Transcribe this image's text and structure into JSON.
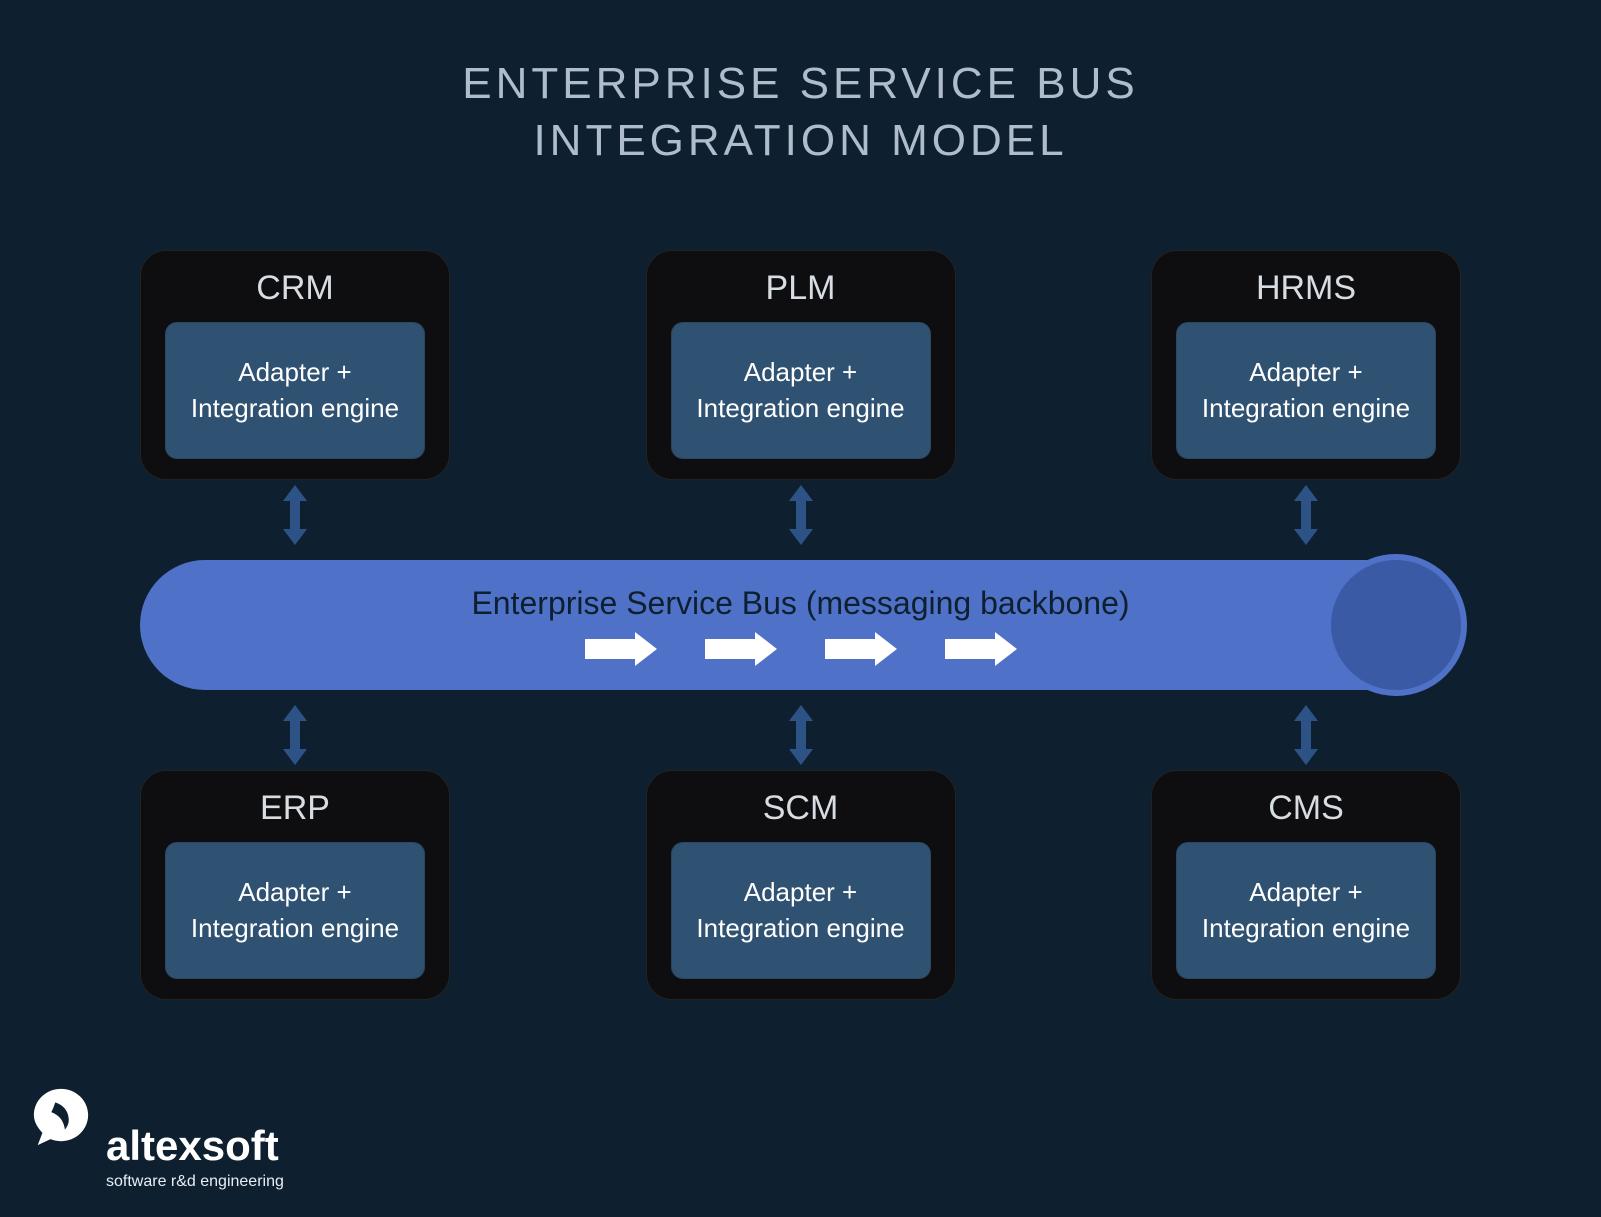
{
  "title_line1": "ENTERPRISE SERVICE BUS",
  "title_line2": "INTEGRATION MODEL",
  "adapter_label": "Adapter + Integration engine",
  "bus_label": "Enterprise Service Bus (messaging backbone)",
  "top_nodes": [
    {
      "name": "CRM"
    },
    {
      "name": "PLM"
    },
    {
      "name": "HRMS"
    }
  ],
  "bottom_nodes": [
    {
      "name": "ERP"
    },
    {
      "name": "SCM"
    },
    {
      "name": "CMS"
    }
  ],
  "logo": {
    "brand": "altexsoft",
    "tagline": "software r&d engineering"
  }
}
